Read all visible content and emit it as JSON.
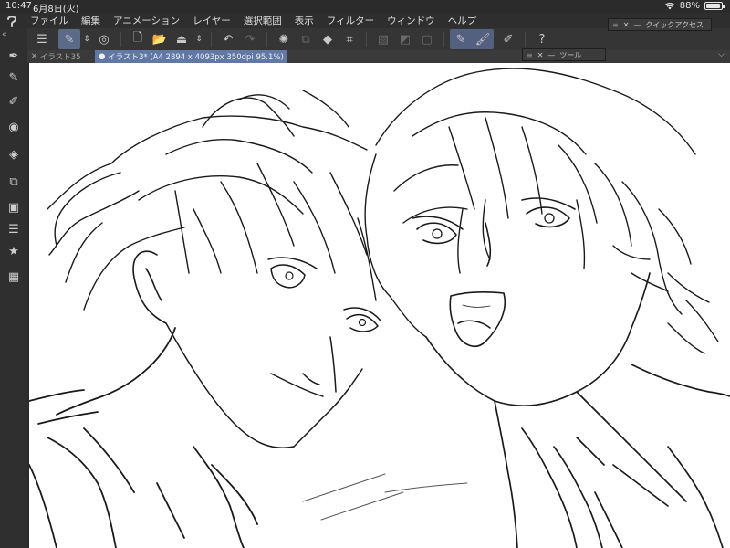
{
  "status": {
    "time": "10:47",
    "date": "6月8日(火)",
    "battery": "88%",
    "battery_level": 0.88
  },
  "menu": {
    "items": [
      "ファイル",
      "編集",
      "アニメーション",
      "レイヤー",
      "選択範囲",
      "表示",
      "フィルター",
      "ウィンドウ",
      "ヘルプ"
    ]
  },
  "tabs": {
    "inactive": "イラスト35",
    "active": "イラスト3* (A4 2894 x 4093px 350dpi 95.1%)"
  },
  "palettes": {
    "quick_access": "クイックアクセス",
    "tool": "ツール"
  },
  "icons": {
    "menu": "hamburger-icon",
    "new": "new-canvas-icon",
    "open": "open-folder-icon",
    "save": "save-icon",
    "undo": "undo-icon",
    "redo": "redo-icon",
    "help": "help-icon"
  }
}
